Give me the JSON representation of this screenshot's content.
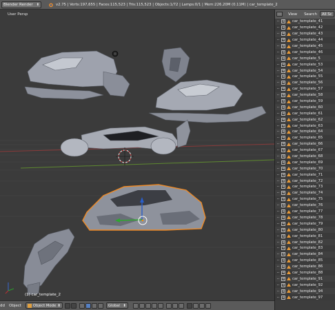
{
  "header": {
    "render_engine": "Blender Render",
    "stats": "v2.75 | Verts:197,655 | Faces:115,523 | Tris:115,523 | Objects:1/72 | Lamps:0/1 | Mem:226.20M (0.11M) | car_template_2"
  },
  "viewport": {
    "view_label": "User Persp",
    "active_object": "(1) car_template_2",
    "colors": {
      "background": "#3b3b3b",
      "grid": "#4a4a4a",
      "x_axis": "#8a3a3a",
      "y_axis": "#6f9a35",
      "selection": "#f08a24"
    }
  },
  "bottom_bar": {
    "cut_left": "dd",
    "object_menu": "Object",
    "mode": "Object Mode",
    "orientation": "Global"
  },
  "outliner": {
    "menu": [
      "View",
      "Search"
    ],
    "scenes_button": "All Sc",
    "items": [
      "car_template_41",
      "car_template_42",
      "car_template_43",
      "car_template_44",
      "car_template_45",
      "car_template_46",
      "car_template_5",
      "car_template_53",
      "car_template_54",
      "car_template_55",
      "car_template_56",
      "car_template_57",
      "car_template_58",
      "car_template_59",
      "car_template_60",
      "car_template_61",
      "car_template_62",
      "car_template_63",
      "car_template_64",
      "car_template_65",
      "car_template_66",
      "car_template_67",
      "car_template_68",
      "car_template_69",
      "car_template_70",
      "car_template_71",
      "car_template_72",
      "car_template_73",
      "car_template_74",
      "car_template_75",
      "car_template_76",
      "car_template_77",
      "car_template_78",
      "car_template_79",
      "car_template_80",
      "car_template_81",
      "car_template_82",
      "car_template_83",
      "car_template_84",
      "car_template_85",
      "car_template_86",
      "car_template_88",
      "car_template_91",
      "car_template_92",
      "car_template_94",
      "car_template_97"
    ]
  }
}
